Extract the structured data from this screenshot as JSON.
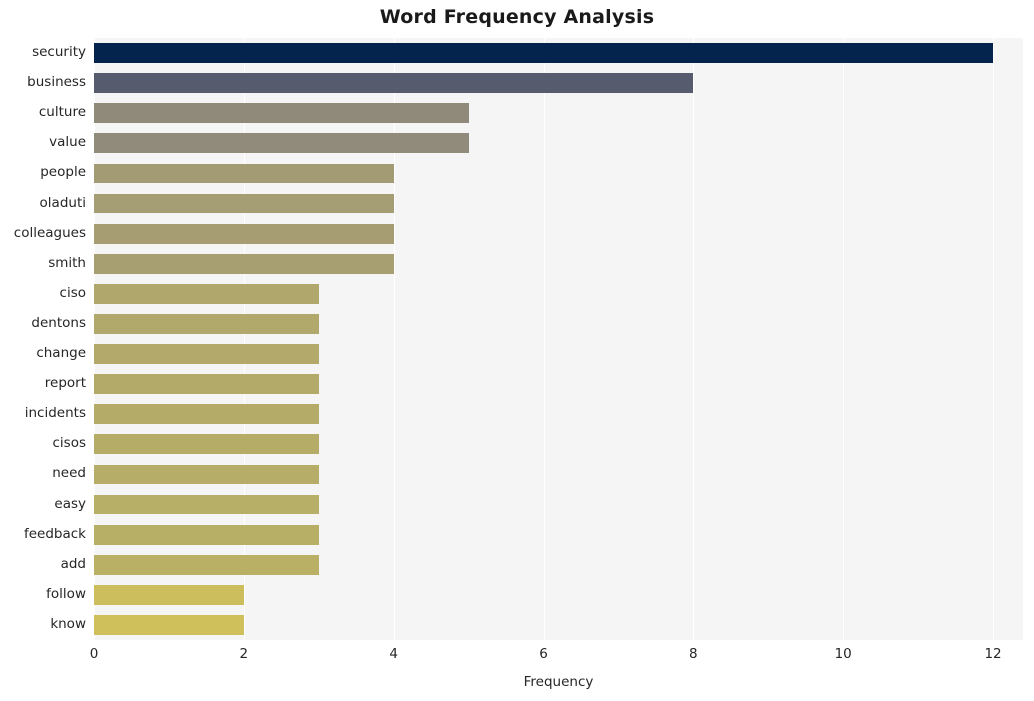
{
  "chart_data": {
    "type": "bar",
    "orientation": "horizontal",
    "title": "Word Frequency Analysis",
    "xlabel": "Frequency",
    "ylabel": "",
    "xlim": [
      0,
      12.4
    ],
    "xticks": [
      0,
      2,
      4,
      6,
      8,
      10,
      12
    ],
    "xtick_labels": [
      "0",
      "2",
      "4",
      "6",
      "8",
      "10",
      "12"
    ],
    "grid": true,
    "grid_axis": "x",
    "legend": false,
    "categories": [
      "security",
      "business",
      "culture",
      "value",
      "people",
      "oladuti",
      "colleagues",
      "smith",
      "ciso",
      "dentons",
      "change",
      "report",
      "incidents",
      "cisos",
      "need",
      "easy",
      "feedback",
      "add",
      "follow",
      "know"
    ],
    "values": [
      12,
      8,
      5,
      5,
      4,
      4,
      4,
      4,
      3,
      3,
      3,
      3,
      3,
      3,
      3,
      3,
      3,
      3,
      2,
      2
    ],
    "bar_colors": [
      "#04234d",
      "#565b6e",
      "#908a7a",
      "#918b7b",
      "#a39b74",
      "#a59d73",
      "#a69e72",
      "#a79f71",
      "#b0a76c",
      "#b1a86c",
      "#b2a96b",
      "#b3aa6a",
      "#b4ab69",
      "#b5ac68",
      "#b6ad68",
      "#b7ae67",
      "#b8af66",
      "#b9b065",
      "#cdbe5d",
      "#cfc05b"
    ],
    "plot_background": "#f5f5f5",
    "gridline_color": "#ffffff",
    "figure_background": "#ffffff"
  }
}
